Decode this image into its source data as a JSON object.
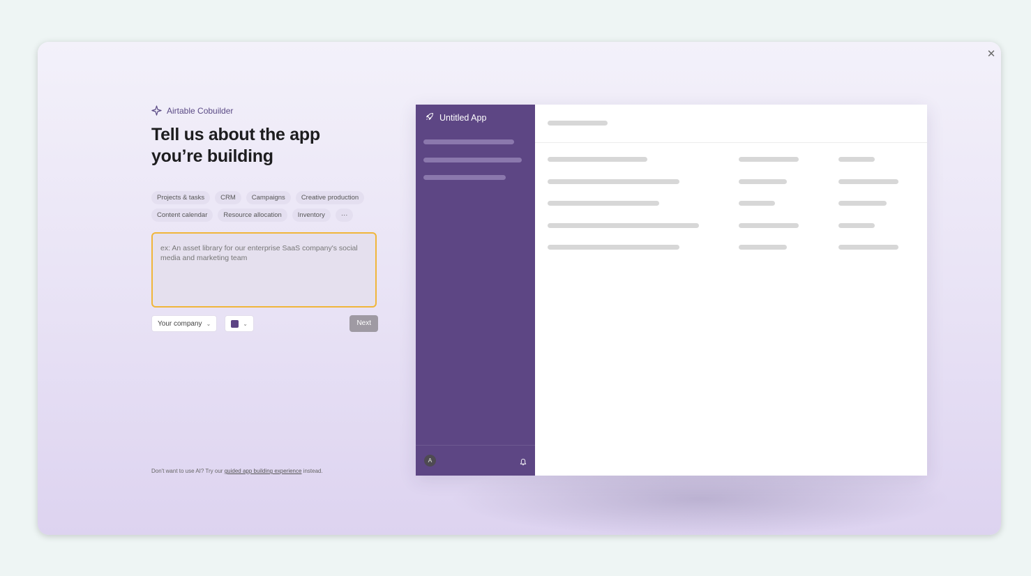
{
  "brand": {
    "name": "Airtable Cobuilder",
    "icon": "sparkle-icon"
  },
  "heading": {
    "line1": "Tell us about the app",
    "line2": "you’re building"
  },
  "chips": [
    "Projects & tasks",
    "CRM",
    "Campaigns",
    "Creative production",
    "Content calendar",
    "Resource allocation",
    "Inventory",
    "···"
  ],
  "prompt": {
    "placeholder": "ex: An asset library for our enterprise SaaS company's social media and marketing team",
    "value": ""
  },
  "company_select": {
    "label": "Your company"
  },
  "color_select": {
    "color": "#5c4384"
  },
  "next_label": "Next",
  "footnote": {
    "before": "Don't want to use AI? Try our ",
    "link": "guided app building experience",
    "after": " instead."
  },
  "preview": {
    "app_title": "Untitled App",
    "avatar_initial": "A",
    "sidebar_color": "#5d4684"
  },
  "colors": {
    "accent": "#5d4684",
    "focus_border": "#f0b63a",
    "next_button": "#9f9aa3"
  }
}
